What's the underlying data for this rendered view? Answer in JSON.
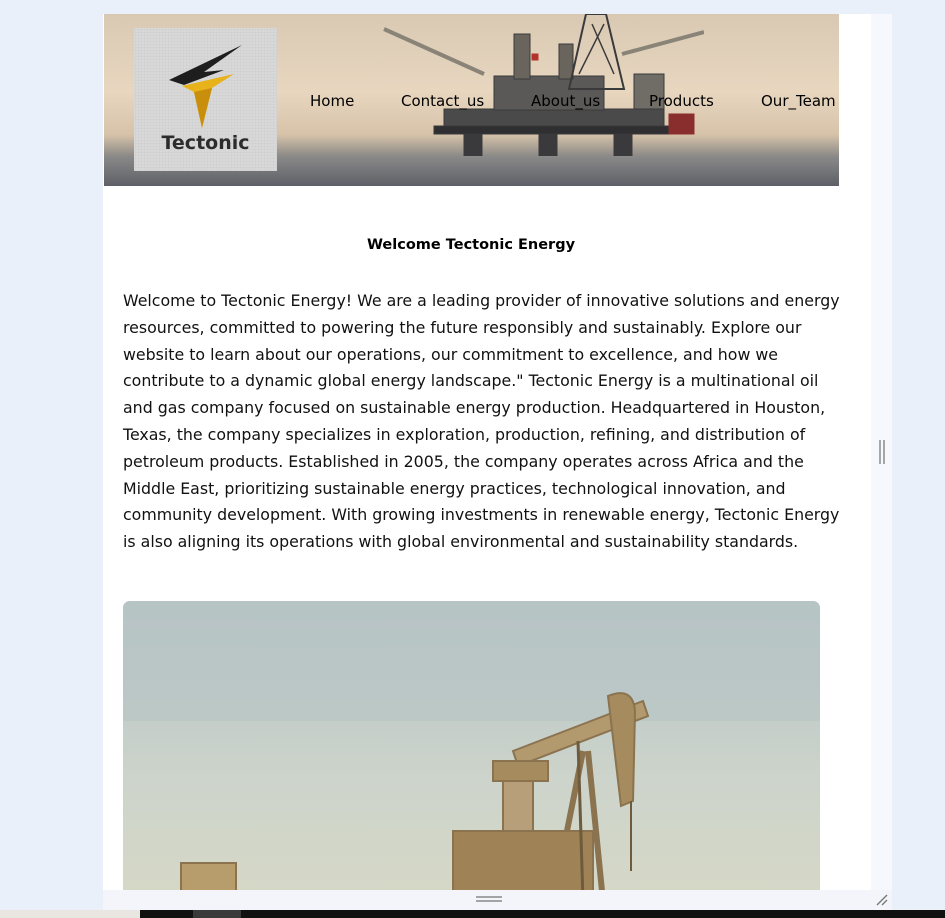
{
  "brand": {
    "logo_text": "Tectonic"
  },
  "nav": {
    "items": [
      {
        "label": "Home"
      },
      {
        "label": "Contact_us"
      },
      {
        "label": "About_us"
      },
      {
        "label": "Products"
      },
      {
        "label": "Our_Team"
      }
    ]
  },
  "main": {
    "headline": "Welcome Tectonic Energy",
    "intro": "Welcome to Tectonic Energy! We are a leading provider of innovative solutions and energy resources, committed to powering the future responsibly and sustainably. Explore our website to learn about our operations, our commitment to excellence, and how we contribute to a dynamic global energy landscape.\" Tectonic Energy is a multinational oil and gas company focused on sustainable energy production. Headquartered in Houston, Texas, the company specializes in exploration, production, refining, and distribution of petroleum products. Established in 2005, the company operates across Africa and the Middle East, prioritizing sustainable energy practices, technological innovation, and community development. With growing investments in renewable energy, Tectonic Energy is also aligning its operations with global environmental and sustainability standards."
  },
  "icons": {
    "logo": "tectonic-logo-icon",
    "scroll_grip": "vertical-grip-icon",
    "horizontal_grip": "horizontal-grip-icon",
    "resize": "resize-corner-icon"
  },
  "colors": {
    "logo_accent": "#e8b21b",
    "logo_dark": "#1e1e1e",
    "page_bg": "#eaf0fa"
  }
}
